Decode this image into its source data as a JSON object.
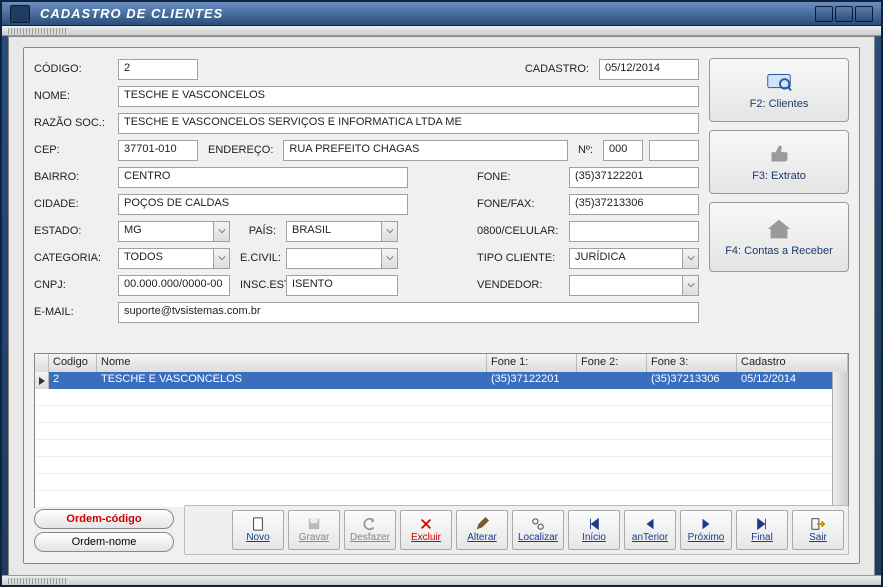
{
  "window": {
    "title": "CADASTRO DE CLIENTES"
  },
  "labels": {
    "codigo": "CÓDIGO:",
    "cadastro": "CADASTRO:",
    "nome": "NOME:",
    "razao": "RAZÃO SOC.:",
    "cep": "CEP:",
    "endereco": "ENDEREÇO:",
    "numero": "Nº:",
    "bairro": "BAIRRO:",
    "fone": "FONE:",
    "cidade": "CIDADE:",
    "fonefax": "FONE/FAX:",
    "estado": "ESTADO:",
    "pais": "PAÍS:",
    "celular": "0800/CELULAR:",
    "categoria": "CATEGORIA:",
    "ecivil": "E.CIVIL:",
    "tipocliente": "TIPO CLIENTE:",
    "cnpj": "CNPJ:",
    "inscest": "INSC.EST:",
    "vendedor": "VENDEDOR:",
    "email": "E-MAIL:"
  },
  "fields": {
    "codigo": "2",
    "cadastro": "05/12/2014",
    "nome": "TESCHE E VASCONCELOS",
    "razao": "TESCHE E VASCONCELOS SERVIÇOS E INFORMATICA LTDA ME",
    "cep": "37701-010",
    "endereco": "RUA PREFEITO CHAGAS",
    "numero": "000",
    "compl": "",
    "bairro": "CENTRO",
    "fone": "(35)37122201",
    "cidade": "POÇOS DE CALDAS",
    "fonefax": "(35)37213306",
    "estado": "MG",
    "pais": "BRASIL",
    "celular": "",
    "categoria": "TODOS",
    "ecivil": "",
    "tipocliente": "JURÍDICA",
    "cnpj": "00.000.000/0000-00",
    "inscest": "ISENTO",
    "vendedor": "",
    "email": "suporte@tvsistemas.com.br"
  },
  "side_buttons": {
    "f2": "F2: Clientes",
    "f3": "F3: Extrato",
    "f4": "F4: Contas a Receber"
  },
  "grid": {
    "headers": {
      "codigo": "Codigo",
      "nome": "Nome",
      "fone1": "Fone 1:",
      "fone2": "Fone 2:",
      "fone3": "Fone 3:",
      "cadastro": "Cadastro"
    },
    "row": {
      "codigo": "2",
      "nome": "TESCHE E VASCONCELOS",
      "fone1": "(35)37122201",
      "fone2": "",
      "fone3": "(35)37213306",
      "cadastro": "05/12/2014"
    }
  },
  "sort": {
    "codigo": "Ordem-código",
    "nome": "Ordem-nome"
  },
  "nav": {
    "novo": "Novo",
    "gravar": "Gravar",
    "desfazer": "Desfazer",
    "excluir": "Excluir",
    "alterar": "Alterar",
    "localizar": "Localizar",
    "inicio": "Início",
    "anterior": "anTerior",
    "proximo": "Próximo",
    "final": "Final",
    "sair": "Sair"
  }
}
